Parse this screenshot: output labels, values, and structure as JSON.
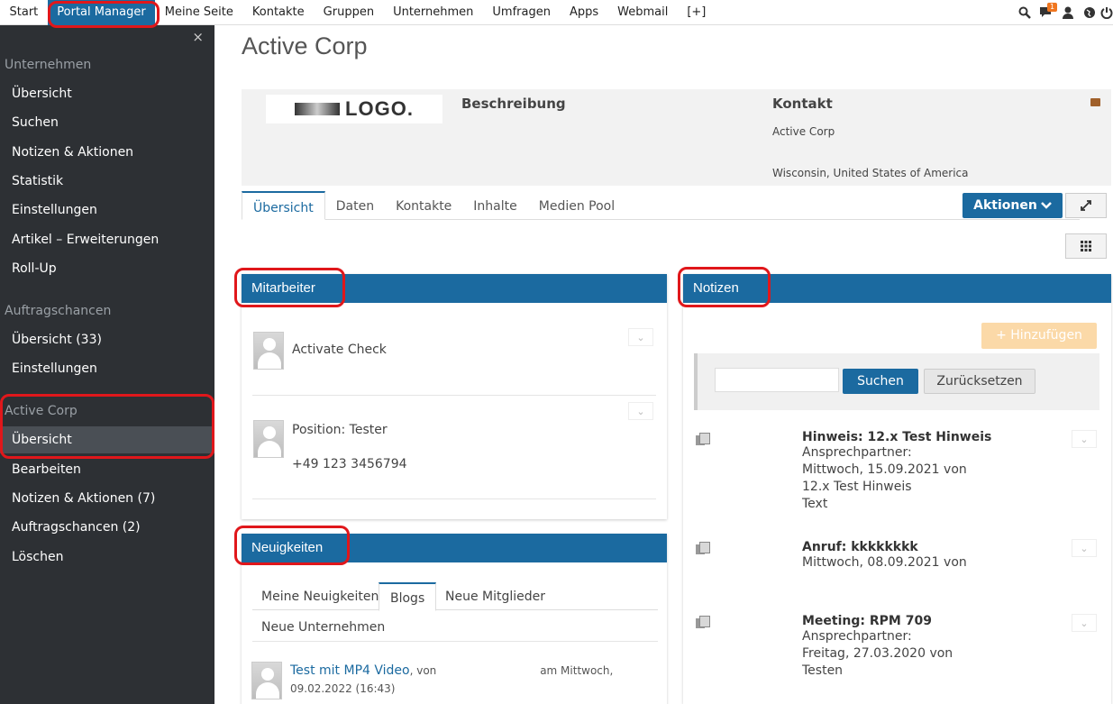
{
  "topnav": {
    "items": [
      "Start",
      "Portal Manager",
      "Meine Seite",
      "Kontakte",
      "Gruppen",
      "Unternehmen",
      "Umfragen",
      "Apps",
      "Webmail",
      "[+]"
    ],
    "notification_count": "1"
  },
  "sidebar": {
    "close_glyph": "×",
    "section1": "Unternehmen",
    "section1_items": [
      "Übersicht",
      "Suchen",
      "Notizen & Aktionen",
      "Statistik",
      "Einstellungen",
      "Artikel – Erweiterungen",
      "Roll-Up"
    ],
    "section2": "Auftragschancen",
    "section2_items": [
      "Übersicht (33)",
      "Einstellungen"
    ],
    "section3": "Active Corp",
    "section3_items": [
      "Übersicht",
      "Bearbeiten",
      "Notizen & Aktionen (7)",
      "Auftragschancen (2)",
      "Löschen"
    ]
  },
  "page": {
    "title": "Active Corp",
    "logo_text": "LOGO.",
    "description_title": "Beschreibung",
    "contact_title": "Kontakt",
    "contact_name": "Active Corp",
    "contact_location": "Wisconsin, United States of America",
    "tabs": [
      "Übersicht",
      "Daten",
      "Kontakte",
      "Inhalte",
      "Medien Pool"
    ],
    "actions_label": "Aktionen"
  },
  "mitarbeiter": {
    "title": "Mitarbeiter",
    "entries": [
      {
        "name": "Activate Check"
      },
      {
        "position": "Position: Tester",
        "phone": "+49 123 3456794"
      }
    ]
  },
  "neuigkeiten": {
    "title": "Neuigkeiten",
    "tabs": [
      "Meine Neuigkeiten",
      "Blogs",
      "Neue Mitglieder",
      "Neue Unternehmen"
    ],
    "post_title": "Test mit MP4 Video",
    "post_by": ", von",
    "post_when": "am Mittwoch,",
    "post_date": "09.02.2022 (16:43)"
  },
  "notizen": {
    "title": "Notizen",
    "add_label": "+ Hinzufügen",
    "search_label": "Suchen",
    "reset_label": "Zurücksetzen",
    "search_value": "",
    "items": [
      {
        "title": "Hinweis: 12.x Test Hinweis",
        "lines": [
          "Ansprechpartner:",
          "Mittwoch, 15.09.2021 von",
          "12.x Test Hinweis",
          "Text"
        ]
      },
      {
        "title": "Anruf: kkkkkkkk",
        "lines": [
          "Mittwoch, 08.09.2021 von"
        ]
      },
      {
        "title": "Meeting: RPM 709",
        "lines": [
          "Ansprechpartner:",
          "Freitag, 27.03.2020 von",
          "Testen"
        ]
      }
    ]
  },
  "colors": {
    "accent": "#1b6aa0",
    "sidebar": "#2d3034",
    "highlight": "#e0171b"
  }
}
